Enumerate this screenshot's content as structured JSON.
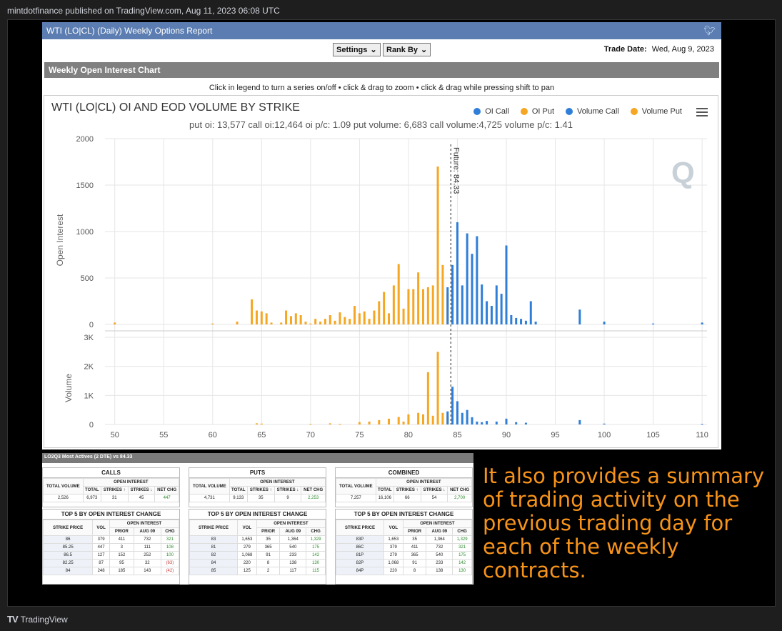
{
  "topbar": {
    "text": "mintdotfinance published on TradingView.com, Aug 11, 2023 06:08 UTC"
  },
  "bottombar": {
    "logo": "TV",
    "brand": "TradingView"
  },
  "report": {
    "header_title": "WTI (LO|CL) (Daily) Weekly Options Report",
    "twitter_icon": "twitter-icon",
    "settings_label": "Settings",
    "rank_label": "Rank By",
    "trade_date_label": "Trade Date:",
    "trade_date_value": "Wed, Aug 9, 2023",
    "section_title": "Weekly Open Interest Chart",
    "hint": "Click in legend to turn a series on/off • click & drag to zoom • click & drag while pressing shift to pan"
  },
  "chart_data": {
    "type": "bar",
    "title": "WTI (LO|CL) OI AND EOD VOLUME BY STRIKE",
    "subtitle": "put oi: 13,577 call oi:12,464 oi p/c: 1.09 put volume: 6,683 call volume:4,725 volume p/c: 1.41",
    "legend": [
      {
        "name": "OI Call",
        "color": "#2f7ed8"
      },
      {
        "name": "OI Put",
        "color": "#f5a623"
      },
      {
        "name": "Volume Call",
        "color": "#2f7ed8"
      },
      {
        "name": "Volume Put",
        "color": "#f5a623"
      }
    ],
    "legend_position": "top-right",
    "xlim": [
      49,
      110.5
    ],
    "x_ticks": [
      "50",
      "55",
      "60",
      "65",
      "70",
      "75",
      "80",
      "85",
      "90",
      "95",
      "100",
      "105",
      "110"
    ],
    "oi_axis": {
      "label": "Open Interest",
      "ylim": [
        0,
        2000
      ],
      "ticks": [
        "0",
        "500",
        "1000",
        "1500",
        "2000"
      ]
    },
    "volume_axis": {
      "label": "Volume",
      "ylim": [
        0,
        3000
      ],
      "ticks": [
        "0",
        "1K",
        "2K",
        "3K"
      ]
    },
    "future_line": {
      "x": 84.33,
      "label": "Future: 84.33"
    },
    "watermark": "Q",
    "oi_put": [
      [
        50,
        20
      ],
      [
        60,
        10
      ],
      [
        62.5,
        30
      ],
      [
        64,
        270
      ],
      [
        64.5,
        150
      ],
      [
        65,
        140
      ],
      [
        65.5,
        120
      ],
      [
        66,
        20
      ],
      [
        67,
        20
      ],
      [
        67.5,
        150
      ],
      [
        68,
        90
      ],
      [
        68.5,
        120
      ],
      [
        69,
        100
      ],
      [
        69.5,
        30
      ],
      [
        70,
        10
      ],
      [
        70.5,
        60
      ],
      [
        71,
        30
      ],
      [
        71.5,
        60
      ],
      [
        72,
        100
      ],
      [
        72.5,
        40
      ],
      [
        73,
        130
      ],
      [
        73.5,
        80
      ],
      [
        74,
        60
      ],
      [
        74.5,
        200
      ],
      [
        75,
        120
      ],
      [
        75.5,
        140
      ],
      [
        76,
        60
      ],
      [
        76.5,
        150
      ],
      [
        77,
        250
      ],
      [
        77.5,
        350
      ],
      [
        78,
        120
      ],
      [
        78.5,
        420
      ],
      [
        79,
        650
      ],
      [
        79.5,
        170
      ],
      [
        80,
        380
      ],
      [
        80.5,
        380
      ],
      [
        81,
        560
      ],
      [
        81.5,
        380
      ],
      [
        82,
        400
      ],
      [
        82.5,
        420
      ],
      [
        83,
        1700
      ],
      [
        83.5,
        640
      ],
      [
        84,
        340
      ],
      [
        84.5,
        500
      ],
      [
        85,
        100
      ],
      [
        86,
        30
      ],
      [
        87,
        20
      ],
      [
        88,
        20
      ],
      [
        89,
        30
      ]
    ],
    "oi_call": [
      [
        84,
        400
      ],
      [
        84.5,
        640
      ],
      [
        85,
        1100
      ],
      [
        85.5,
        420
      ],
      [
        86,
        980
      ],
      [
        86.5,
        760
      ],
      [
        87,
        950
      ],
      [
        87.5,
        430
      ],
      [
        88,
        250
      ],
      [
        88.5,
        200
      ],
      [
        89,
        420
      ],
      [
        89.5,
        330
      ],
      [
        90,
        850
      ],
      [
        90.5,
        100
      ],
      [
        91,
        70
      ],
      [
        91.5,
        60
      ],
      [
        92,
        40
      ],
      [
        92.5,
        250
      ],
      [
        93,
        30
      ],
      [
        97.5,
        160
      ],
      [
        100,
        30
      ],
      [
        105,
        10
      ],
      [
        110,
        20
      ]
    ],
    "vol_put": [
      [
        64.5,
        40
      ],
      [
        65,
        30
      ],
      [
        70,
        20
      ],
      [
        72,
        40
      ],
      [
        73,
        20
      ],
      [
        75,
        80
      ],
      [
        76,
        100
      ],
      [
        77,
        150
      ],
      [
        78,
        200
      ],
      [
        79,
        260
      ],
      [
        79.5,
        100
      ],
      [
        80,
        350
      ],
      [
        81,
        400
      ],
      [
        81.5,
        350
      ],
      [
        82,
        1800
      ],
      [
        82.5,
        300
      ],
      [
        83,
        2500
      ],
      [
        83.5,
        400
      ],
      [
        84,
        300
      ]
    ],
    "vol_call": [
      [
        84,
        450
      ],
      [
        84.5,
        1300
      ],
      [
        85,
        800
      ],
      [
        85.5,
        400
      ],
      [
        86,
        500
      ],
      [
        86.5,
        250
      ],
      [
        87,
        100
      ],
      [
        87.5,
        80
      ],
      [
        88,
        120
      ],
      [
        89,
        100
      ],
      [
        90,
        200
      ],
      [
        91,
        80
      ],
      [
        92,
        60
      ],
      [
        97.5,
        150
      ],
      [
        100,
        30
      ],
      [
        110,
        20
      ]
    ]
  },
  "tables": {
    "title": "LO2Q3 Most Actives (2 DTE) vs 84.33",
    "calls": {
      "title": "CALLS",
      "oi_title": "OPEN INTEREST",
      "h_total_volume": "TOTAL VOLUME",
      "h_total": "TOTAL",
      "h_strikes_up": "STRIKES ↑",
      "h_strikes_down": "STRIKES ↓",
      "h_net_chg": "NET CHG",
      "total_volume": "2,526",
      "total": "6,973",
      "strikes_up": "31",
      "strikes_down": "45",
      "net_chg": "447"
    },
    "puts": {
      "title": "PUTS",
      "oi_title": "OPEN INTEREST",
      "h_total_volume": "TOTAL VOLUME",
      "h_total": "TOTAL",
      "h_strikes_up": "STRIKES ↑",
      "h_strikes_down": "STRIKES ↓",
      "h_net_chg": "NET CHG",
      "total_volume": "4,731",
      "total": "9,133",
      "strikes_up": "35",
      "strikes_down": "9",
      "net_chg": "2,253"
    },
    "combined": {
      "title": "COMBINED",
      "oi_title": "OPEN INTEREST",
      "h_total_volume": "TOTAL VOLUME",
      "h_total": "TOTAL",
      "h_strikes_up": "STRIKES ↑",
      "h_strikes_down": "STRIKES ↓",
      "h_net_chg": "NET CHG",
      "total_volume": "7,257",
      "total": "16,106",
      "strikes_up": "66",
      "strikes_down": "54",
      "net_chg": "2,700"
    },
    "top_title": "TOP 5 BY OPEN INTEREST CHANGE",
    "h_strike_price": "STRIKE PRICE",
    "h_vol": "VOL",
    "h_oi": "OPEN INTEREST",
    "h_prior": "PRIOR",
    "h_aug09": "AUG 09",
    "h_chg": "CHG",
    "top_calls": [
      [
        "86",
        "379",
        "411",
        "732",
        "321"
      ],
      [
        "85.25",
        "447",
        "3",
        "111",
        "108"
      ],
      [
        "86.5",
        "127",
        "152",
        "252",
        "100"
      ],
      [
        "82.25",
        "87",
        "95",
        "32",
        "(63)"
      ],
      [
        "84",
        "248",
        "185",
        "143",
        "(42)"
      ]
    ],
    "top_puts": [
      [
        "83",
        "1,653",
        "35",
        "1,364",
        "1,329"
      ],
      [
        "81",
        "279",
        "365",
        "540",
        "175"
      ],
      [
        "82",
        "1,068",
        "91",
        "233",
        "142"
      ],
      [
        "84",
        "220",
        "8",
        "138",
        "130"
      ],
      [
        "85",
        "125",
        "2",
        "117",
        "115"
      ]
    ],
    "top_combined": [
      [
        "83P",
        "1,653",
        "35",
        "1,364",
        "1,329"
      ],
      [
        "86C",
        "379",
        "411",
        "732",
        "321"
      ],
      [
        "81P",
        "279",
        "365",
        "540",
        "175"
      ],
      [
        "82P",
        "1,068",
        "91",
        "233",
        "142"
      ],
      [
        "84P",
        "220",
        "8",
        "138",
        "130"
      ]
    ]
  },
  "caption": {
    "text": "It also provides a summary of trading activity on the previous trading day for each of the weekly contracts."
  }
}
